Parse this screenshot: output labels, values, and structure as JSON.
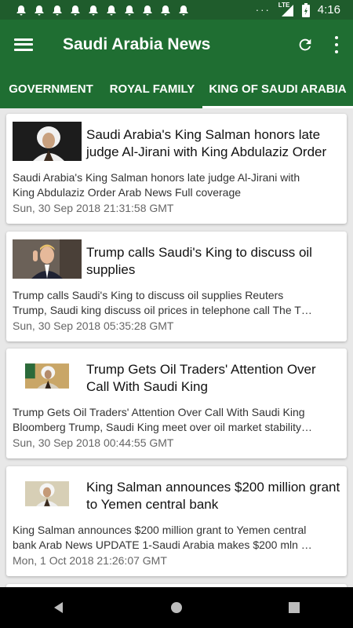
{
  "status_bar": {
    "time": "4:16",
    "network": "LTE",
    "more": "···",
    "notification_icons": [
      "bell-icon",
      "bell-icon",
      "bell-icon",
      "bell-icon",
      "bell-icon",
      "bell-icon",
      "bell-icon",
      "bell-icon",
      "bell-icon",
      "bell-icon",
      "bell-icon"
    ]
  },
  "app_bar": {
    "title": "Saudi Arabia News",
    "menu_icon": "menu-icon",
    "refresh_icon": "refresh-icon",
    "overflow_icon": "more-vert-icon"
  },
  "tabs": [
    {
      "label": "GOVERNMENT",
      "active": false
    },
    {
      "label": "ROYAL FAMILY",
      "active": false
    },
    {
      "label": "KING OF SAUDI ARABIA",
      "active": true
    }
  ],
  "articles": [
    {
      "title": "Saudi Arabia's King Salman honors late judge Al-Jirani with King Abdulaziz Order",
      "desc_line1": "Saudi Arabia's King Salman honors late judge Al-Jirani with",
      "desc_line2": "King Abdulaziz Order  Arab News  Full coverage",
      "date": "Sun, 30 Sep 2018 21:31:58 GMT"
    },
    {
      "title": "Trump calls Saudi's King to discuss oil supplies",
      "desc_line1": "Trump calls Saudi's King to discuss oil supplies  Reuters",
      "desc_line2": "Trump, Saudi king discuss oil prices in telephone call  The T…",
      "date": "Sun, 30 Sep 2018 05:35:28 GMT"
    },
    {
      "title": "Trump Gets Oil Traders' Attention Over Call With Saudi King",
      "desc_line1": "Trump Gets Oil Traders' Attention Over Call With Saudi King",
      "desc_line2": "Bloomberg  Trump, Saudi King meet over oil market stability…",
      "date": "Sun, 30 Sep 2018 00:44:55 GMT"
    },
    {
      "title": "King Salman announces $200 million grant to Yemen central bank",
      "desc_line1": "King Salman announces $200 million grant to Yemen central",
      "desc_line2": "bank  Arab News  UPDATE 1-Saudi Arabia makes $200 mln …",
      "date": "Mon, 1 Oct 2018 21:26:07 GMT"
    }
  ],
  "nav_bar": {
    "back_icon": "back-icon",
    "home_icon": "home-icon",
    "recents_icon": "recents-icon"
  },
  "colors": {
    "primary": "#1f6e32",
    "status_bar": "#1f5c2c",
    "background": "#e8e8e8"
  }
}
